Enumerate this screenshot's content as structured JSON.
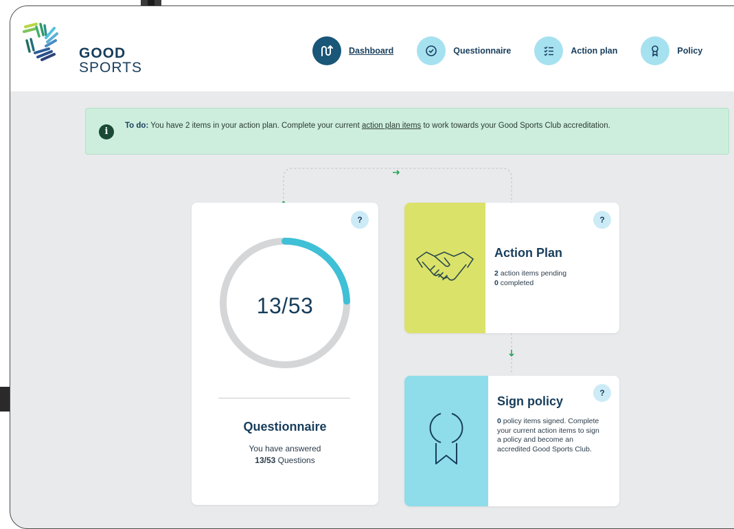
{
  "brand": {
    "line1": "GOOD",
    "line2": "SPORTS"
  },
  "nav": [
    {
      "label": "Dashboard",
      "icon": "route-icon",
      "active": true
    },
    {
      "label": "Questionnaire",
      "icon": "check-circle-icon",
      "active": false
    },
    {
      "label": "Action plan",
      "icon": "checklist-icon",
      "active": false
    },
    {
      "label": "Policy",
      "icon": "ribbon-icon",
      "active": false
    }
  ],
  "alert": {
    "prefix": "To do:",
    "text_before": "You have 2 items in your action plan. Complete your current",
    "link": "action plan items",
    "text_after": "to work towards your Good Sports Club accreditation.",
    "icon": "info-icon"
  },
  "questionnaire": {
    "progress_label": "13/53",
    "answered": 13,
    "total": 53,
    "title": "Questionnaire",
    "line1": "You have answered",
    "count": "13/53",
    "line2_suffix": "Questions",
    "help": "?"
  },
  "action_plan": {
    "title": "Action Plan",
    "pending_count": "2",
    "pending_text": "action items pending",
    "completed_count": "0",
    "completed_text": "completed",
    "icon": "handshake-icon",
    "help": "?"
  },
  "sign_policy": {
    "title": "Sign policy",
    "signed_count": "0",
    "description": "policy items signed. Complete your current action items to sign a policy and become an accredited Good Sports Club.",
    "icon": "award-ribbon-icon",
    "help": "?"
  },
  "colors": {
    "navy": "#173d5b",
    "nav_active": "#195678",
    "nav_icon_bg": "#a6e1f0",
    "alert_bg": "#cdeedd",
    "progress": "#3fc0d6",
    "ring_track": "#d5d6d8",
    "action_panel": "#dbe26a",
    "policy_panel": "#8fdcea",
    "arrow": "#27a35a"
  }
}
